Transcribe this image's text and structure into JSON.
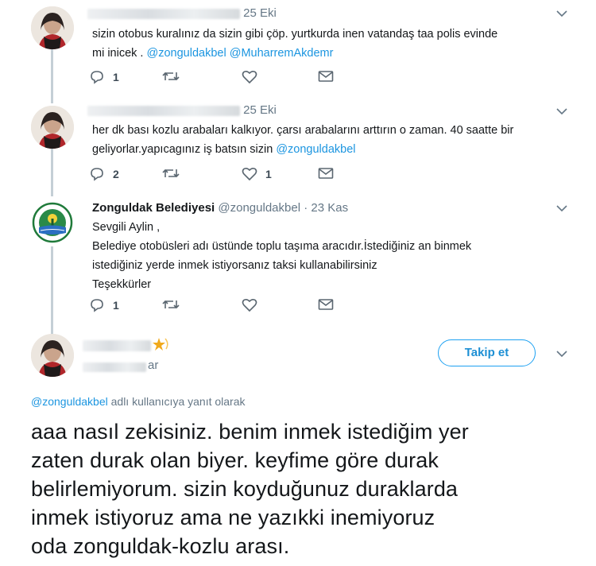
{
  "tweets": [
    {
      "date": "25 Eki",
      "text_plain": "sizin otobus kuralınız da sizin gibi çöp. yurtkurda inen vatandaş taa polis evinde\nmi inicek . ",
      "mentions": [
        "@zonguldakbel",
        "@MuharremAkdemr"
      ],
      "reply_count": "1",
      "like_count": ""
    },
    {
      "date": "25 Eki",
      "text_plain": "her dk bası kozlu arabaları kalkıyor. çarsı arabalarını arttırın o zaman. 40 saatte bir\ngeliyorlar.yapıcagınız iş batsın sizin ",
      "mentions": [
        "@zonguldakbel"
      ],
      "reply_count": "2",
      "like_count": "1"
    },
    {
      "name": "Zonguldak Belediyesi",
      "handle": "@zonguldakbel",
      "date": "· 23 Kas",
      "text": "Sevgili Aylin ,\nBelediye otobüsleri adı üstünde toplu taşıma aracıdır.İstediğiniz an binmek\nistediğiniz yerde inmek istiyorsanız taksi kullanabilirsiniz\nTeşekkürler",
      "reply_count": "1",
      "like_count": ""
    }
  ],
  "main_tweet": {
    "handle_fragment": "ar",
    "follow_label": "Takip et",
    "replying_handle": "@zonguldakbel",
    "replying_text": " adlı kullanıcıya yanıt olarak",
    "text": "aaa nasıl zekisiniz. benim inmek istediğim yer\nzaten durak olan biyer. keyfime göre durak\nbelirlemiyorum. sizin koyduğunuz duraklarda\ninmek istiyoruz ama ne yazıkki inemiyoruz\noda zonguldak-kozlu arası."
  },
  "colors": {
    "accent": "#1da1f2",
    "mention": "#1b95e0",
    "muted": "#657786",
    "thread_line": "#c4cfd6"
  },
  "icons": [
    "reply-icon",
    "retweet-icon",
    "like-icon",
    "message-icon",
    "chevron-down-icon",
    "star-badge-icon",
    "municipality-logo-icon"
  ]
}
